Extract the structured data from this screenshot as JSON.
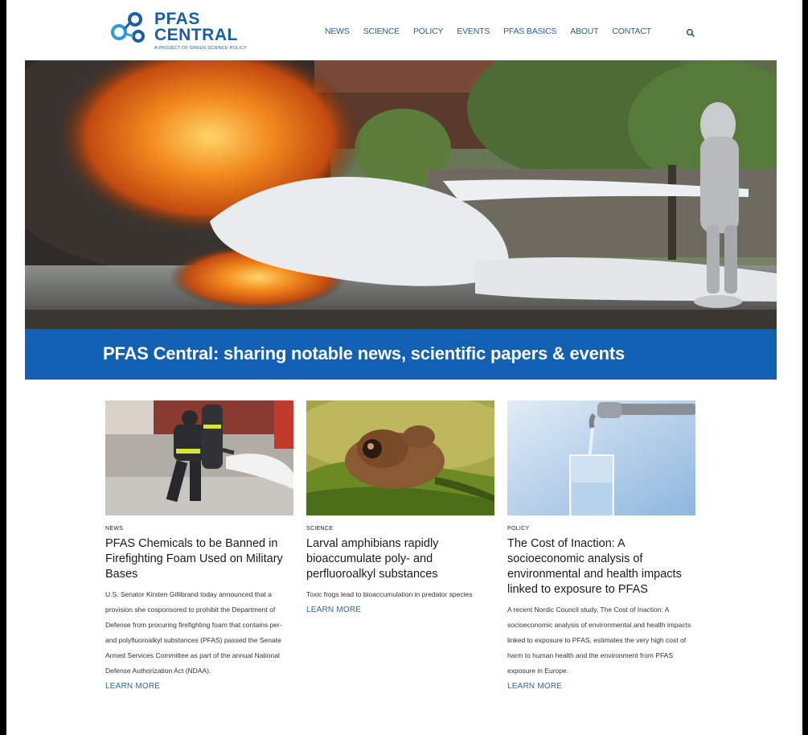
{
  "site": {
    "logo_line1": "PFAS",
    "logo_line2": "CENTRAL",
    "logo_tagline": "A PROJECT OF GREEN SCIENCE POLICY"
  },
  "nav": {
    "items": [
      "NEWS",
      "SCIENCE",
      "POLICY",
      "EVENTS",
      "PFAS BASICS",
      "ABOUT",
      "CONTACT"
    ]
  },
  "hero": {
    "headline": "PFAS Central: sharing notable news, scientific papers & events"
  },
  "cards": [
    {
      "category": "NEWS",
      "title": "PFAS Chemicals to be Banned in Firefighting Foam Used on Military Bases",
      "description": "U.S. Senator Kirsten Gillibrand today announced that a provision she cosponsored to prohibit the Department of Defense from procuring firefighting foam that contains per- and polyfluoroalkyl substances (PFAS) passed the Senate Armed Services Committee as part of the annual National Defense Authorization Act (NDAA).",
      "link": "LEARN MORE"
    },
    {
      "category": "SCIENCE",
      "title": "Larval amphibians rapidly bioaccumulate poly- and perfluoroalkyl substances",
      "description": "Toxic frogs lead to bioaccumulation in predator species",
      "link": "LEARN MORE"
    },
    {
      "category": "POLICY",
      "title": "The Cost of Inaction: A socioeconomic analysis of environmental and health impacts linked to exposure to PFAS",
      "description": "A recent Nordic Council study, The Cost of Inaction: A socioeconomic analysis of environmental and health impacts linked to exposure to PFAS, estimates the very high cost of harm to human health and the environment from PFAS exposure in Europe.",
      "link": "LEARN MORE"
    }
  ],
  "colors": {
    "brand_blue": "#1260b3",
    "nav_text": "#2a5d9a"
  }
}
